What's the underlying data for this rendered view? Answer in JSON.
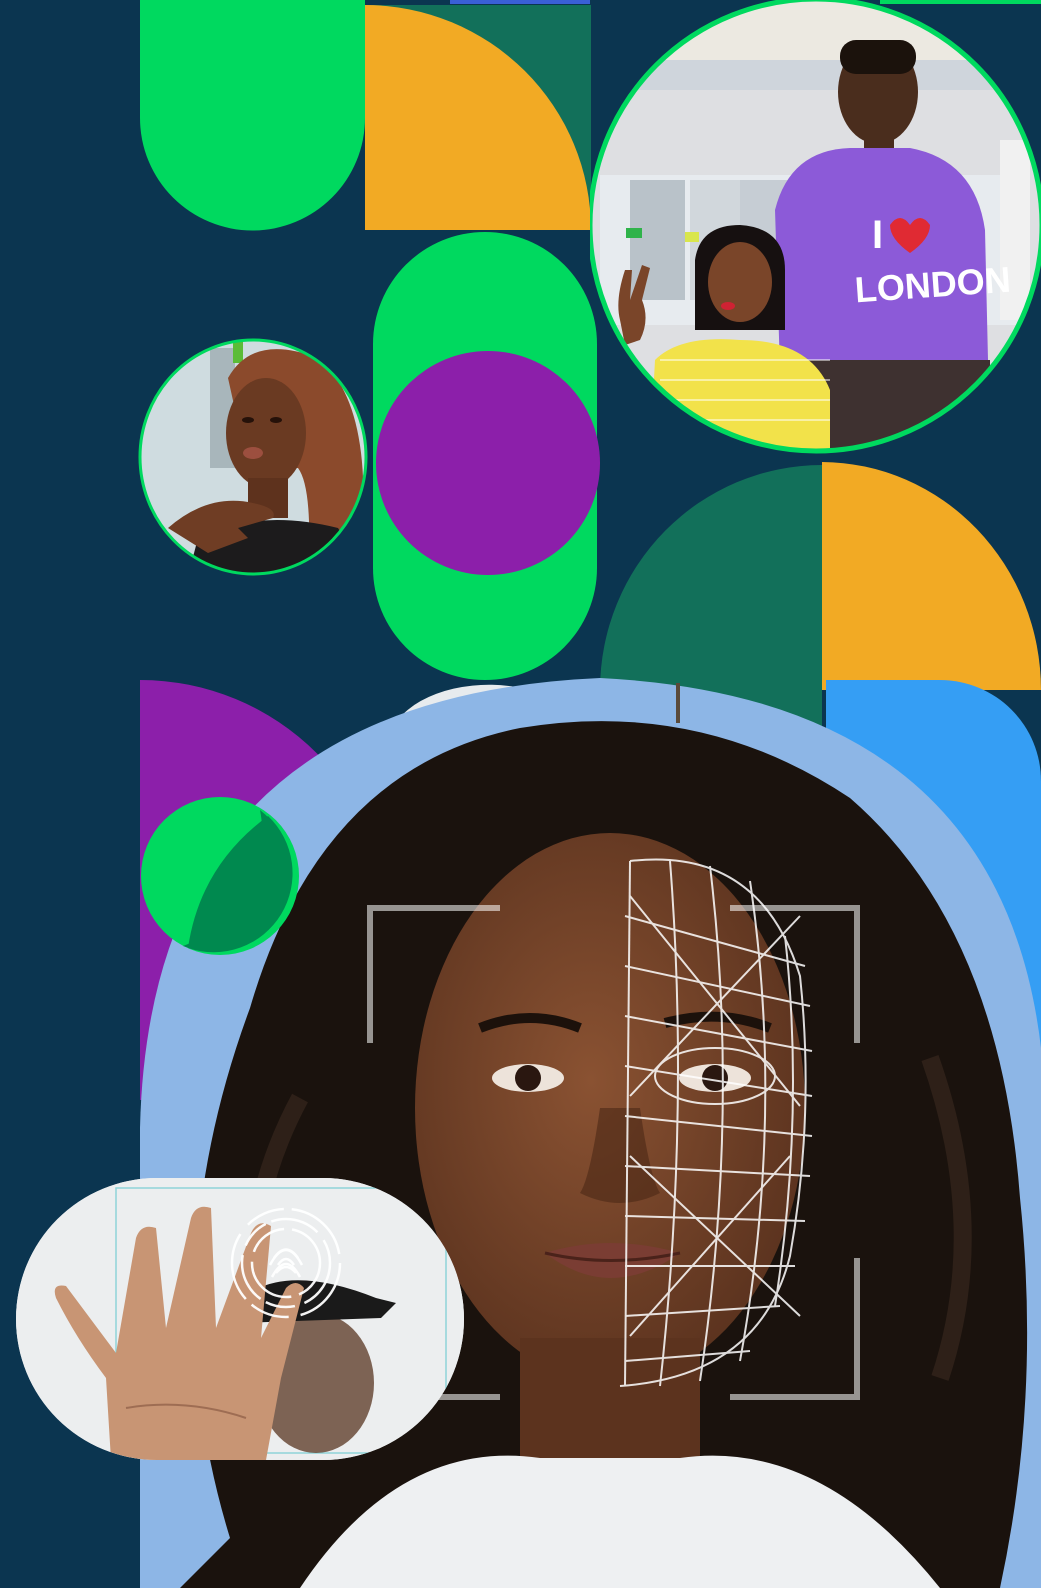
{
  "palette": {
    "background": "#0b3550",
    "green": "#00d95f",
    "orange": "#f2aa24",
    "dark_green": "#12705a",
    "purple": "#8c1faa",
    "blue": "#359ef4",
    "sky": "#8db6e6",
    "overlap_green": "#00894f"
  },
  "images": {
    "group_photo": "two-people-selfie-in-office",
    "woman_photo": "woman-speaking-hand-on-chest",
    "portrait": "woman-face-recognition-mesh",
    "fingerprint": "hand-fingerprint-scan"
  },
  "decorations": {
    "face_mesh": "face-mesh-icon",
    "scan_frame": "scan-frame-icon",
    "fingerprint": "fingerprint-icon"
  },
  "shirt_text": "I ♥ LONDON"
}
